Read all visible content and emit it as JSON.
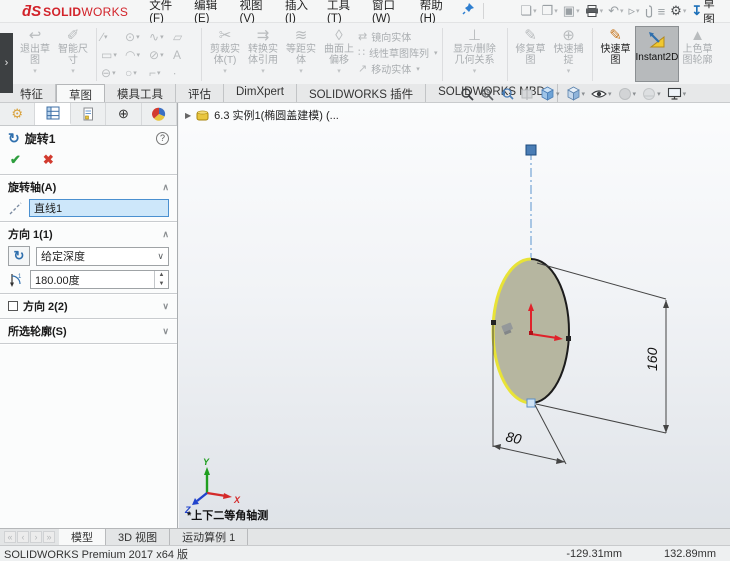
{
  "titlebar": {
    "logo_mark": "ƌS",
    "logo_bold": "SOLID",
    "logo_light": "WORKS",
    "menus": [
      "文件(F)",
      "编辑(E)",
      "视图(V)",
      "插入(I)",
      "工具(T)",
      "窗口(W)",
      "帮助(H)"
    ],
    "corner_label": "草图"
  },
  "icons": {
    "new": "❏",
    "open": "❒",
    "save": "▣",
    "undo": "↶",
    "select": "▹",
    "list": "≡",
    "gear": "⚙",
    "rebuild": "↧",
    "caret": "▾",
    "strip": "›",
    "expand": "▶",
    "check": "✔",
    "cross": "✖",
    "help": "?",
    "chevron_up": "∧",
    "chevron_down": "∨",
    "revolve": "↻",
    "exit": "↩",
    "smartdim": "✐",
    "trim": "✂",
    "convert": "⇉",
    "offset": "≋",
    "surf": "◊",
    "mirror": "⇄",
    "pattern": "∷",
    "move": "↗",
    "relations": "⊥",
    "repair": "✎",
    "snap": "⊕",
    "rapid": "✎",
    "shaded": "▲",
    "dimxpert": "⊕",
    "nav": [
      "«",
      "‹",
      "›",
      "»"
    ]
  },
  "ribbon": {
    "exit_sketch": "退出草\n图",
    "smart_dim": "智能尺\n寸",
    "grid": [
      [
        "∕",
        "⊙",
        "∿",
        "▱"
      ],
      [
        "▭",
        "◠",
        "⊘",
        "A"
      ],
      [
        "⊖",
        "○",
        "⌐",
        "∙"
      ]
    ],
    "trim": "剪裁实\n体(T)",
    "convert": "转换实\n体引用",
    "offset": "等距实\n体",
    "surface_offset": "曲面上\n偏移",
    "mirror": "镜向实体",
    "linear_pattern": "线性草图阵列",
    "move": "移动实体",
    "relations": "显示/删除\n几何关系",
    "repair": "修复草\n图",
    "quick_snap": "快速捕\n捉",
    "rapid_sketch": "快速草\n图",
    "instant2d": "Instant2D",
    "shaded_contours": "上色草\n图轮廓"
  },
  "command_tabs": {
    "items": [
      "特征",
      "草图",
      "模具工具",
      "评估",
      "DimXpert",
      "SOLIDWORKS 插件",
      "SOLIDWORKS MBD"
    ]
  },
  "property_manager": {
    "feature_title": "旋转1",
    "axis_group": {
      "label": "旋转轴(A)",
      "value": "直线1"
    },
    "dir1_group": {
      "label": "方向 1(1)",
      "condition": "给定深度",
      "angle": "180.00度"
    },
    "dir2_group": {
      "label": "方向 2(2)"
    },
    "contours_group": {
      "label": "所选轮廓(S)"
    }
  },
  "viewport": {
    "doc_tree": "6.3 实例1(椭圆盖建模) (...",
    "view_name": "*上下二等角轴测",
    "dim_width": "80",
    "dim_height": "160",
    "triad": {
      "x": "X",
      "y": "Y",
      "z": "Z"
    }
  },
  "bottom_bar": {
    "tabs": [
      "模型",
      "3D 视图",
      "运动算例 1"
    ]
  },
  "status_bar": {
    "version": "SOLIDWORKS Premium 2017 x64 版",
    "coord_x": "-129.31mm",
    "coord_y": "132.89mm"
  }
}
